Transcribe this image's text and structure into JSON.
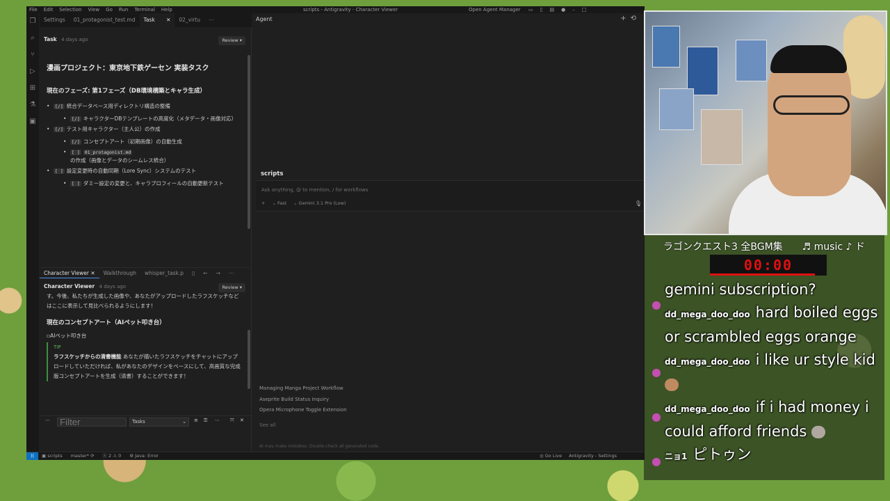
{
  "ide": {
    "menu": [
      "File",
      "Edit",
      "Selection",
      "View",
      "Go",
      "Run",
      "Terminal",
      "Help"
    ],
    "window_title": "scripts - Antigravity - Character Viewer",
    "open_agent_manager": "Open Agent Manager",
    "tabs": [
      "Settings",
      "01_protagonist_test.md",
      "Task",
      "02_virtu"
    ],
    "task_doc": {
      "name": "Task",
      "time": "4 days ago",
      "review": "Review",
      "title": "漫画プロジェクト：東京地下鉄ゲーセン 実装タスク",
      "phase": "現在のフェーズ: 第1フェーズ（DB環境構築とキャラ生成）",
      "items": [
        {
          "check": "[/]",
          "text": "統合データベース用ディレクトリ構造の整備"
        },
        {
          "check": "[/]",
          "text": "キャラクターDBテンプレートの高度化（メタデータ・画像対応）"
        },
        {
          "check": "[/]",
          "text": "テスト用キャラクター（主人公）の作成"
        },
        {
          "check": "[/]",
          "text": "コンセプトアート（初期画像）の自動生成"
        },
        {
          "check": "[ ]",
          "code": "01_protagonist.md",
          "text": "の作成（画像とデータのシームレス統合）"
        },
        {
          "check": "[ ]",
          "text": "設定変更時の自動同期（Lore Sync）システムのテスト"
        },
        {
          "check": "[ ]",
          "text": "ダミー設定の変更と、キャラプロフィールの自動更新テスト"
        }
      ]
    },
    "lower_tabs": [
      "Character Viewer",
      "Walkthrough",
      "whisper_task.p"
    ],
    "character_viewer": {
      "name": "Character Viewer",
      "time": "4 days ago",
      "review": "Review",
      "intro": "す。今後、私たちが生成した画像や、あなたがアップロードしたラフスケッチなどはここに表示して見比べられるようにします！",
      "heading": "現在のコンセプトアート（AIペット叩き台）",
      "image_alt": "AIペット叩き台",
      "tip_label": "TIP",
      "tip_bold": "ラフスケッチからの清書機能",
      "tip_text": "あなたが描いたラフスケッチをチャットにアップロードしていただければ、私があなたのデザインをベースにして、高画質な完成版コンセプトアートを生成（清書）することができます！"
    },
    "filter_placeholder": "Filter",
    "tasks_select": "Tasks",
    "agent": {
      "header": "Agent",
      "workspace": "scripts",
      "placeholder": "Ask anything, @ to mention, / for workflows",
      "mode": "Fast",
      "model": "Gemini 3.1 Pro (Low)",
      "recent": [
        "Managing Manga Project Workflow",
        "Aseprite Build Status Inquiry",
        "Opera Microphone Toggle Extension"
      ],
      "see_all": "See all",
      "disclaimer": "AI may make mistakes. Double-check all generated code."
    },
    "status": {
      "branch": "scripts",
      "git": "master*",
      "errors": "2",
      "warnings": "0",
      "java": "Java: Error",
      "go_live": "Go Live",
      "settings": "Antigravity - Settings"
    }
  },
  "stream": {
    "now_playing": "ラゴンクエスト3 全BGM集",
    "music_tag": "♬ music ♪ ド",
    "timer": "00:00",
    "timer_progress": 0.9,
    "chat": [
      {
        "user": "",
        "text": "gemini subscription?"
      },
      {
        "user": "dd_mega_doo_doo",
        "text": "hard boiled eggs or scrambled eggs orange"
      },
      {
        "user": "dd_mega_doo_doo",
        "text": "i like ur style kid"
      },
      {
        "user": "dd_mega_doo_doo",
        "text": "if i had money i could afford friends"
      },
      {
        "user": "ニョ1",
        "text": "ピトゥン"
      }
    ]
  }
}
